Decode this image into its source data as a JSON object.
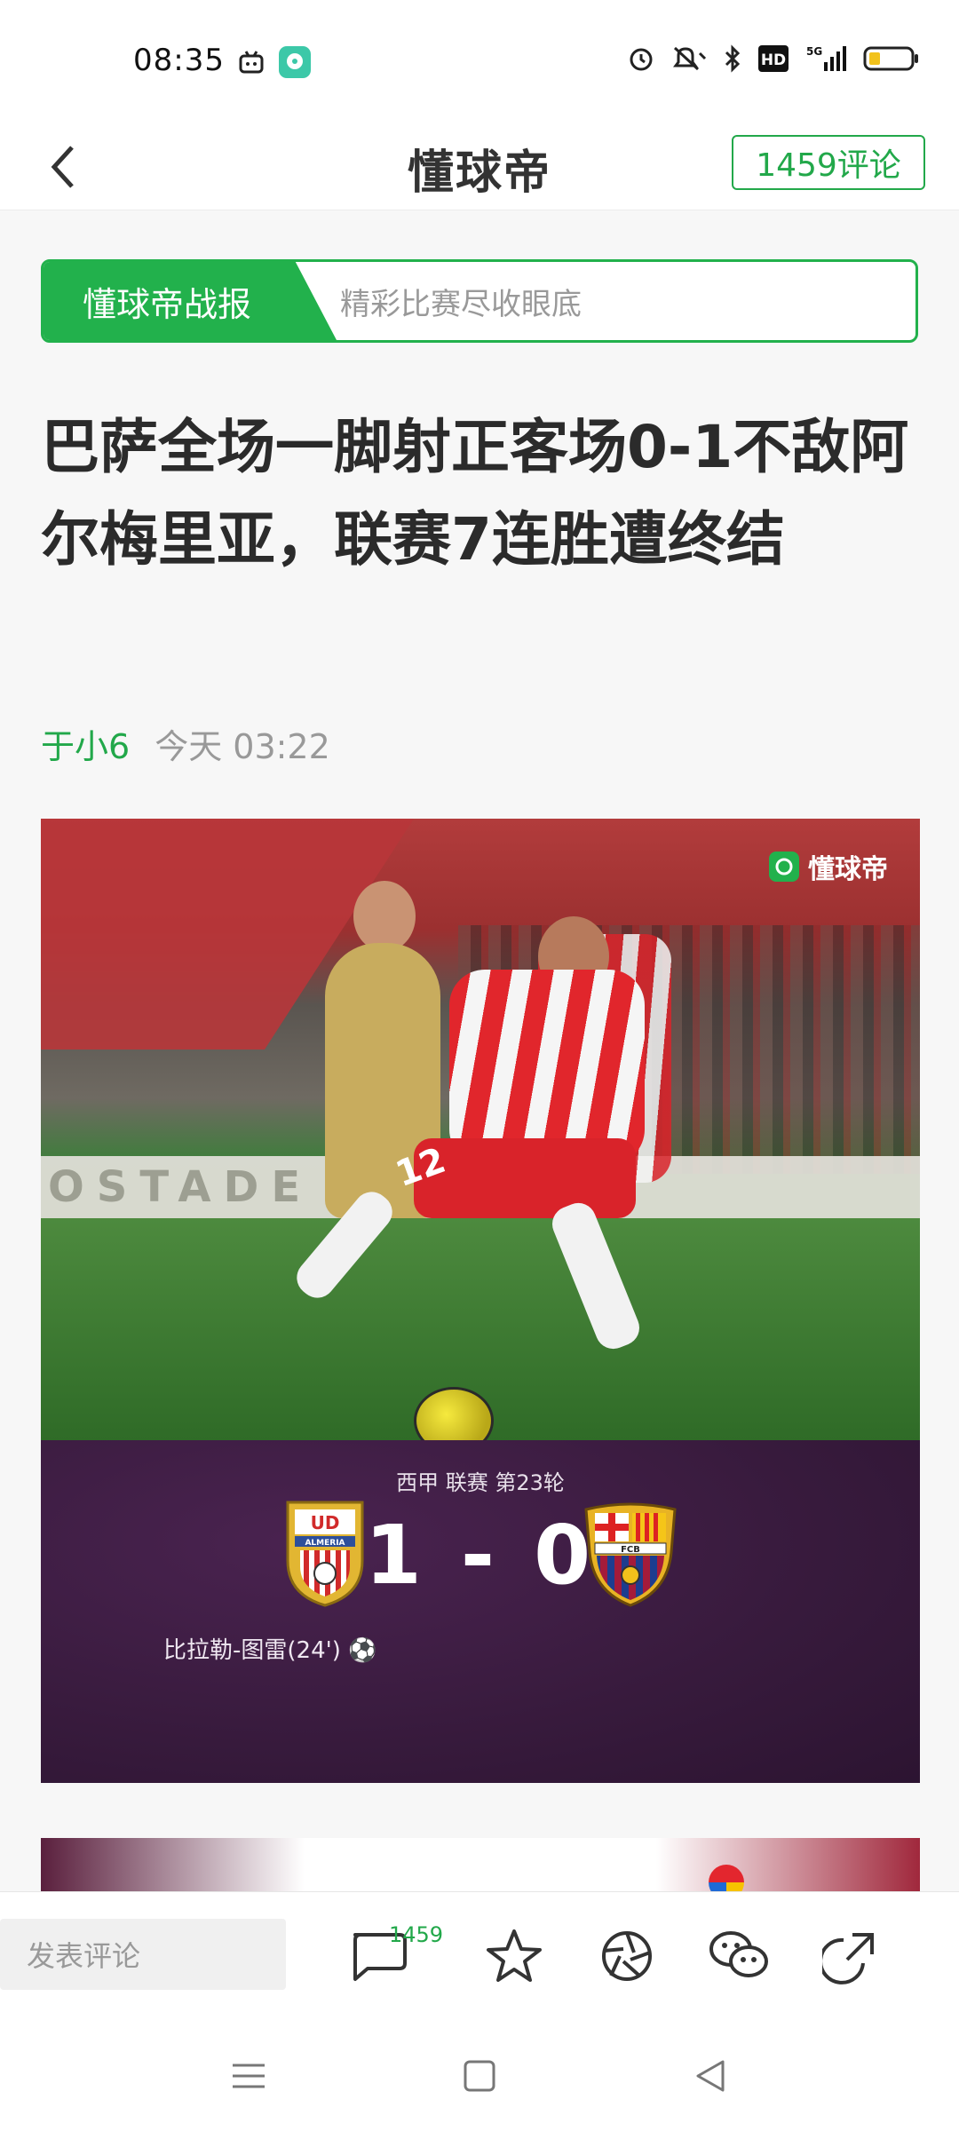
{
  "status_bar": {
    "time": "08:35",
    "left_icons": [
      "bilibili-icon",
      "chat-bubble-app-icon"
    ],
    "right_icons": [
      "alarm-icon",
      "mute-icon",
      "bluetooth-icon",
      "hd-icon",
      "signal-5g-icon",
      "battery-icon"
    ],
    "hd_label": "HD",
    "network_label": "5G"
  },
  "header": {
    "brand": "懂球帝",
    "comment_button": "1459评论",
    "accent_color": "#22a84a"
  },
  "banner": {
    "tag": "懂球帝战报",
    "subtitle": "精彩比赛尽收眼底"
  },
  "article": {
    "title": "巴萨全场一脚射正客场0-1不敌阿尔梅里亚，联赛7连胜遭终结",
    "author": "于小6",
    "time": "今天 03:22"
  },
  "hero_image": {
    "watermark": "懂球帝",
    "shirt_number": "12",
    "ad_board_text": "OSTADE",
    "crest_home_text": "UD",
    "crest_home_name": "ALMERIA",
    "crest_away_text": "FCB",
    "league": "西甲 联赛 第23轮",
    "score": "1 - 0",
    "scorer": "比拉勒-图雷(24') ⚽"
  },
  "toolbar": {
    "comment_placeholder": "发表评论",
    "comment_count": "1459",
    "icons": [
      "comment-icon",
      "star-icon",
      "moments-icon",
      "wechat-icon",
      "share-icon"
    ]
  },
  "navbar": {
    "icons": [
      "menu-icon",
      "home-square-icon",
      "back-triangle-icon"
    ]
  }
}
